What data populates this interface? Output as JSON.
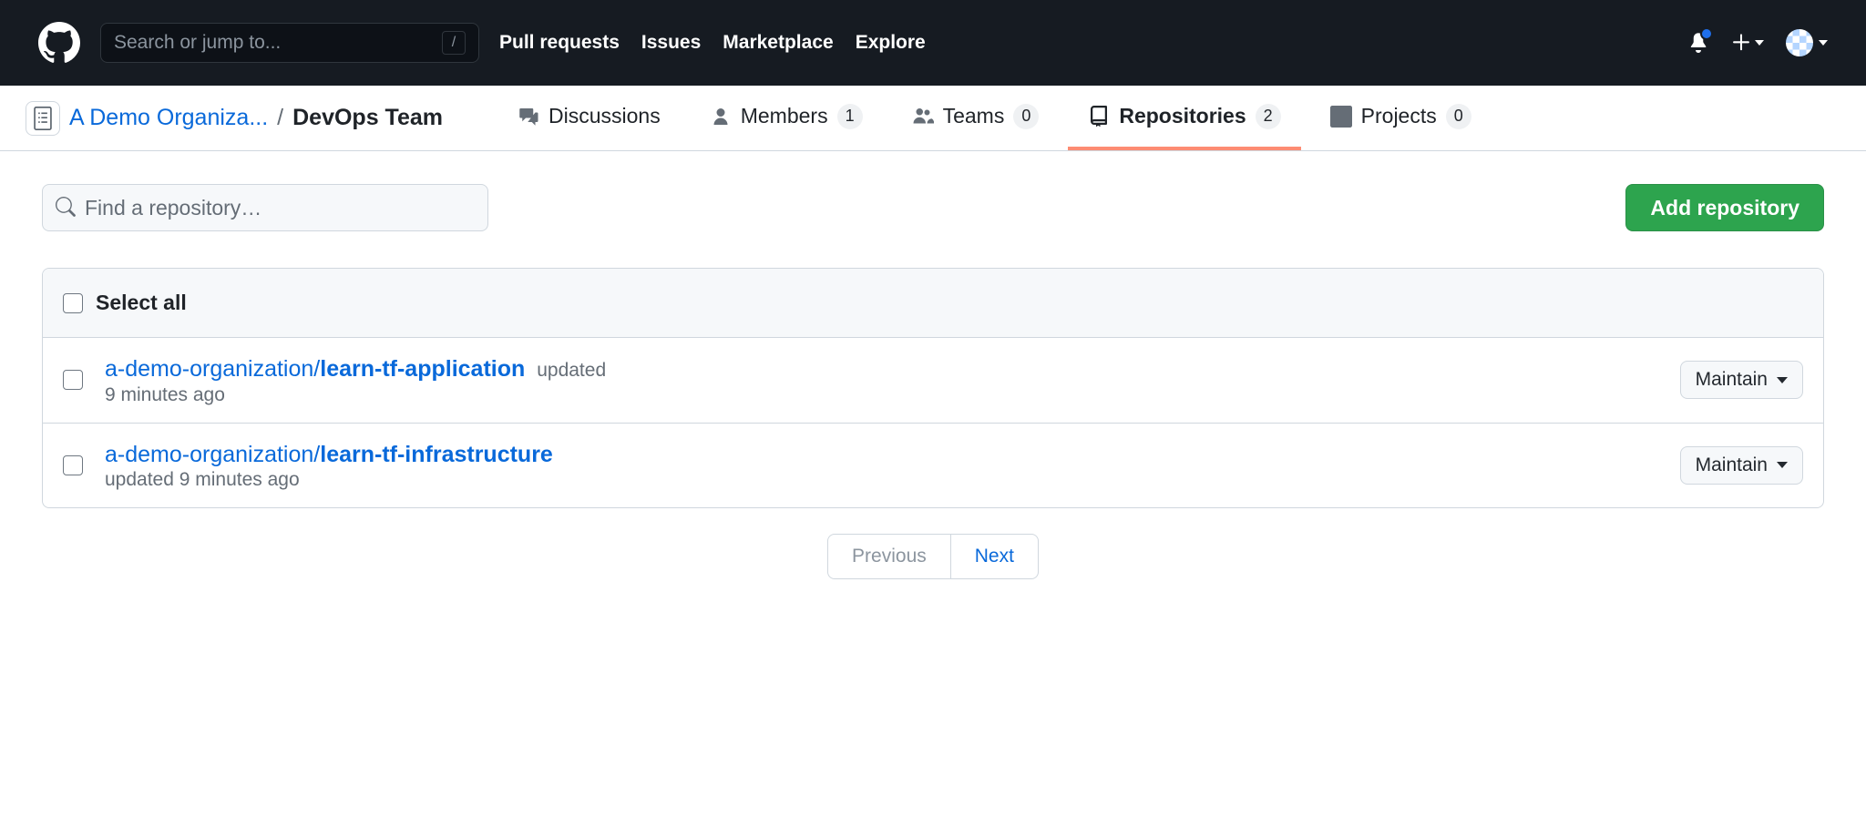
{
  "header": {
    "search_placeholder": "Search or jump to...",
    "search_key": "/",
    "nav": {
      "pull_requests": "Pull requests",
      "issues": "Issues",
      "marketplace": "Marketplace",
      "explore": "Explore"
    }
  },
  "breadcrumb": {
    "org": "A Demo Organiza...",
    "sep": "/",
    "team": "DevOps Team"
  },
  "tabs": {
    "discussions": {
      "label": "Discussions"
    },
    "members": {
      "label": "Members",
      "count": "1"
    },
    "teams": {
      "label": "Teams",
      "count": "0"
    },
    "repositories": {
      "label": "Repositories",
      "count": "2"
    },
    "projects": {
      "label": "Projects",
      "count": "0"
    }
  },
  "controls": {
    "find_placeholder": "Find a repository…",
    "add_button": "Add repository"
  },
  "select_all_label": "Select all",
  "repos": [
    {
      "org": "a-demo-organization",
      "name": "learn-tf-application",
      "meta_inline": "updated",
      "meta_below": "9 minutes ago",
      "permission": "Maintain"
    },
    {
      "org": "a-demo-organization",
      "name": "learn-tf-infrastructure",
      "meta_inline": "",
      "meta_below": "updated 9 minutes ago",
      "permission": "Maintain"
    }
  ],
  "pagination": {
    "prev": "Previous",
    "next": "Next"
  }
}
